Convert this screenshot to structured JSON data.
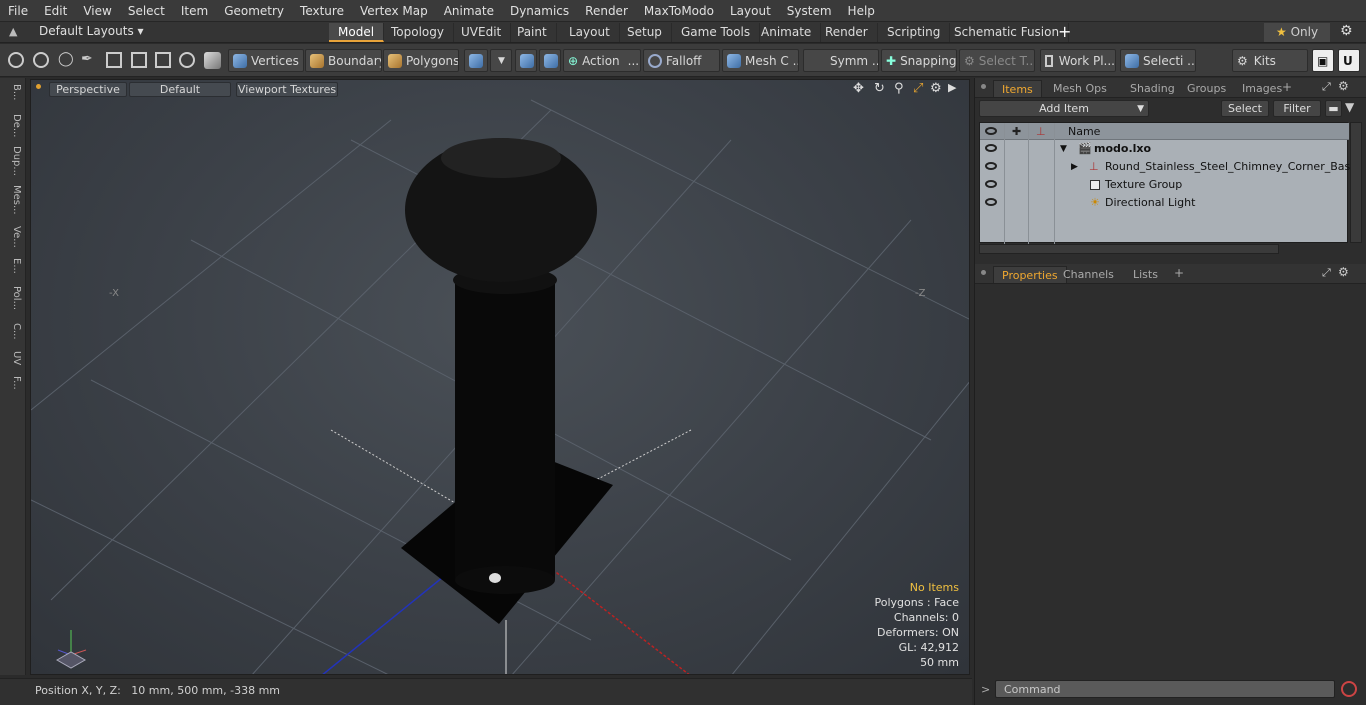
{
  "menu": [
    "File",
    "Edit",
    "View",
    "Select",
    "Item",
    "Geometry",
    "Texture",
    "Vertex Map",
    "Animate",
    "Dynamics",
    "Render",
    "MaxToModo",
    "Layout",
    "System",
    "Help"
  ],
  "layout_selector": "Default Layouts",
  "layout_tabs": [
    "Model",
    "Topology",
    "UVEdit",
    "Paint",
    "Layout",
    "Setup",
    "Game Tools",
    "Animate",
    "Render",
    "Scripting",
    "Schematic Fusion"
  ],
  "only_label": "Only",
  "toolbar": {
    "vertices": "Vertices",
    "boundary": "Boundary",
    "polygons": "Polygons",
    "action": "Action",
    "falloff": "Falloff",
    "mesh": "Mesh C ...",
    "symm": "Symm ...",
    "snapping": "Snapping",
    "select_t": "Select T...",
    "work_pl": "Work Pl...",
    "selecti": "Selecti ...",
    "kits": "Kits"
  },
  "left_tabs": [
    "B...",
    "De...",
    "Dup...",
    "Mes...",
    "Ve...",
    "E...",
    "Pol...",
    "C...",
    "UV",
    "F..."
  ],
  "viewport": {
    "perspective": "Perspective",
    "default": "Default",
    "textures": "Viewport Textures",
    "axis_x_label": "-X",
    "axis_z_label": "-Z",
    "info": {
      "no_items": "No Items",
      "polygons": "Polygons : Face",
      "channels": "Channels: 0",
      "deformers": "Deformers: ON",
      "gl": "GL: 42,912",
      "size": "50 mm"
    }
  },
  "status": "Position X, Y, Z:   10 mm, 500 mm, -338 mm",
  "items_panel": {
    "tabs": [
      "Items",
      "Mesh Ops",
      "Shading",
      "Groups",
      "Images"
    ],
    "add_item": "Add Item",
    "select": "Select",
    "filter": "Filter",
    "name_header": "Name",
    "rows": [
      "modo.lxo",
      "Round_Stainless_Steel_Chimney_Corner_Base",
      "Texture Group",
      "Directional Light"
    ]
  },
  "props_panel": {
    "tabs": [
      "Properties",
      "Channels",
      "Lists"
    ]
  },
  "command_placeholder": "Command"
}
